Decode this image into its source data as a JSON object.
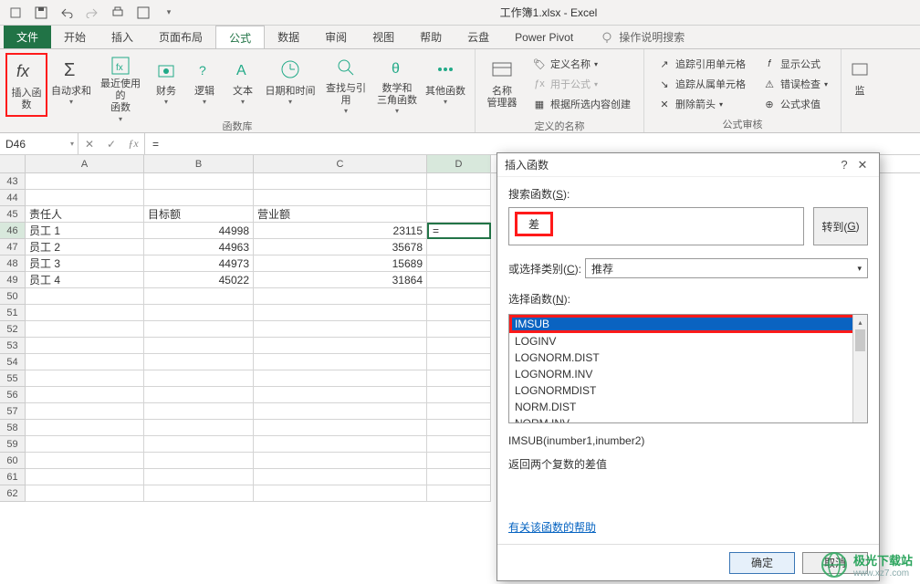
{
  "app": {
    "title": "工作簿1.xlsx - Excel"
  },
  "qat": {
    "save": "save",
    "undo": "undo",
    "redo": "redo",
    "more": "more"
  },
  "tabs": {
    "file": "文件",
    "home": "开始",
    "insert": "插入",
    "pagelayout": "页面布局",
    "formulas": "公式",
    "data": "数据",
    "review": "审阅",
    "view": "视图",
    "help": "帮助",
    "cloud": "云盘",
    "powerpivot": "Power Pivot",
    "tellme": "操作说明搜索"
  },
  "ribbon": {
    "insertfn": "插入函数",
    "autosum": "自动求和",
    "recent": "最近使用的\n函数",
    "financial": "财务",
    "logical": "逻辑",
    "text": "文本",
    "datetime": "日期和时间",
    "lookup": "查找与引用",
    "mathtrig": "数学和\n三角函数",
    "other": "其他函数",
    "group_funclib": "函数库",
    "namemgr": "名称\n管理器",
    "definename": "定义名称",
    "useinformula": "用于公式",
    "createfromsel": "根据所选内容创建",
    "group_names": "定义的名称",
    "tracep": "追踪引用单元格",
    "traced": "追踪从属单元格",
    "removearrows": "删除箭头",
    "showformulas": "显示公式",
    "errorcheck": "错误检查",
    "evaluate": "公式求值",
    "group_audit": "公式审核",
    "watch": "监"
  },
  "namebox": "D46",
  "formula": "=",
  "cols": [
    "A",
    "B",
    "C",
    "D"
  ],
  "rownums": [
    "43",
    "44",
    "45",
    "46",
    "47",
    "48",
    "49",
    "50",
    "51",
    "52",
    "53",
    "54",
    "55",
    "56",
    "57",
    "58",
    "59",
    "60",
    "61",
    "62"
  ],
  "sheet": {
    "headers": {
      "A": "责任人",
      "B": "目标额",
      "C": "营业额"
    },
    "rows": [
      {
        "A": "员工 1",
        "B": "44998",
        "C": "23115"
      },
      {
        "A": "员工 2",
        "B": "44963",
        "C": "35678"
      },
      {
        "A": "员工 3",
        "B": "44973",
        "C": "15689"
      },
      {
        "A": "员工 4",
        "B": "45022",
        "C": "31864"
      }
    ],
    "activeD": "="
  },
  "dialog": {
    "title": "插入函数",
    "search_label_pre": "搜索函数(",
    "search_label_u": "S",
    "search_label_post": "):",
    "search_value": "差",
    "goto": "转到(",
    "goto_u": "G",
    "goto_post": ")",
    "cat_label_pre": "或选择类别(",
    "cat_u": "C",
    "cat_post": "):",
    "cat_value": "推荐",
    "select_label_pre": "选择函数(",
    "select_u": "N",
    "select_post": "):",
    "functions": [
      "IMSUB",
      "LOGINV",
      "LOGNORM.DIST",
      "LOGNORM.INV",
      "LOGNORMDIST",
      "NORM.DIST",
      "NORM.INV"
    ],
    "signature": "IMSUB(inumber1,inumber2)",
    "description": "返回两个复数的差值",
    "help": "有关该函数的帮助",
    "ok": "确定",
    "cancel": "取消"
  },
  "watermark": {
    "name": "极光下载站",
    "url": "www.xz7.com"
  }
}
